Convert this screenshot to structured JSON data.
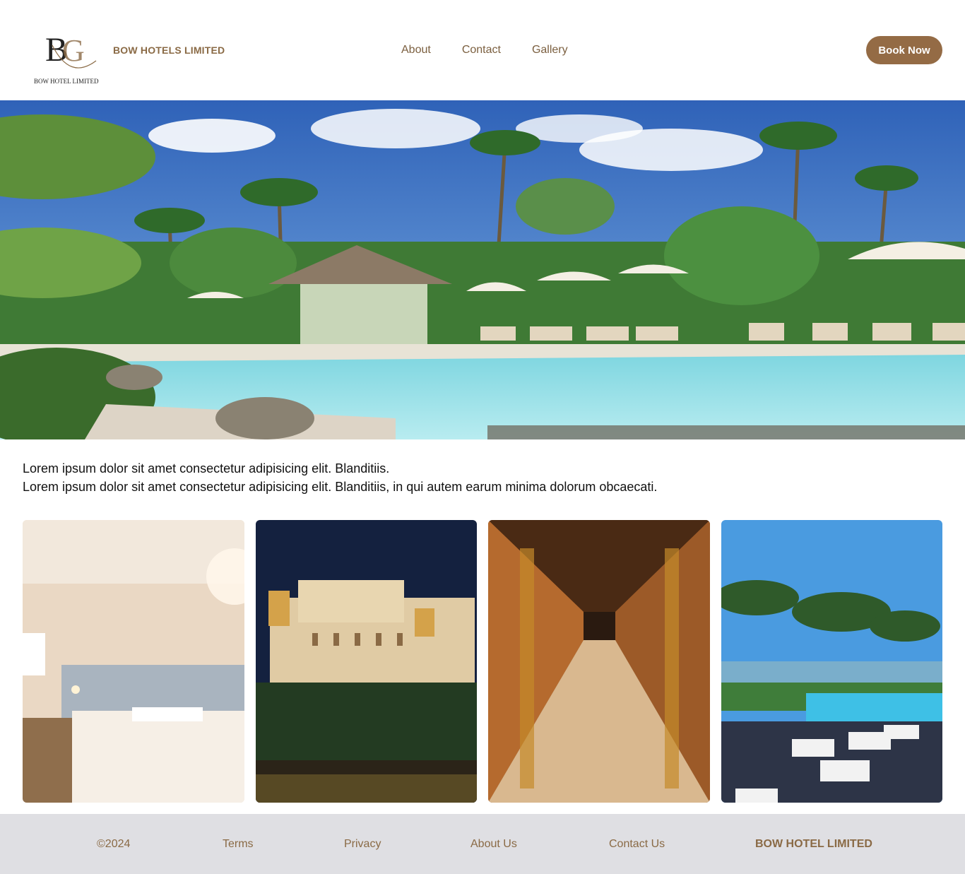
{
  "header": {
    "logo_text": "BOW HOTEL LIMITED",
    "brand": "BOW HOTELS LIMITED",
    "nav": [
      {
        "label": "About"
      },
      {
        "label": "Contact"
      },
      {
        "label": "Gallery"
      }
    ],
    "book_button": "Book Now"
  },
  "hero": {
    "description": "Resort pool with palm trees, umbrellas and loungers"
  },
  "intro": {
    "line1": "Lorem ipsum dolor sit amet consectetur adipisicing elit. Blanditiis.",
    "line2": "Lorem ipsum dolor sit amet consectetur adipisicing elit. Blanditiis, in qui autem earum minima dolorum obcaecati."
  },
  "gallery": [
    {
      "name": "bedroom"
    },
    {
      "name": "palace-at-night"
    },
    {
      "name": "hallway"
    },
    {
      "name": "poolside-terrace"
    }
  ],
  "footer": {
    "copyright": "©2024",
    "terms": "Terms",
    "privacy": "Privacy",
    "about": "About Us",
    "contact": "Contact Us",
    "brand": "BOW HOTEL LIMITED"
  },
  "colors": {
    "accent": "#946b45",
    "brand_text": "#8a6a45",
    "footer_bg": "#dfdfe3"
  }
}
